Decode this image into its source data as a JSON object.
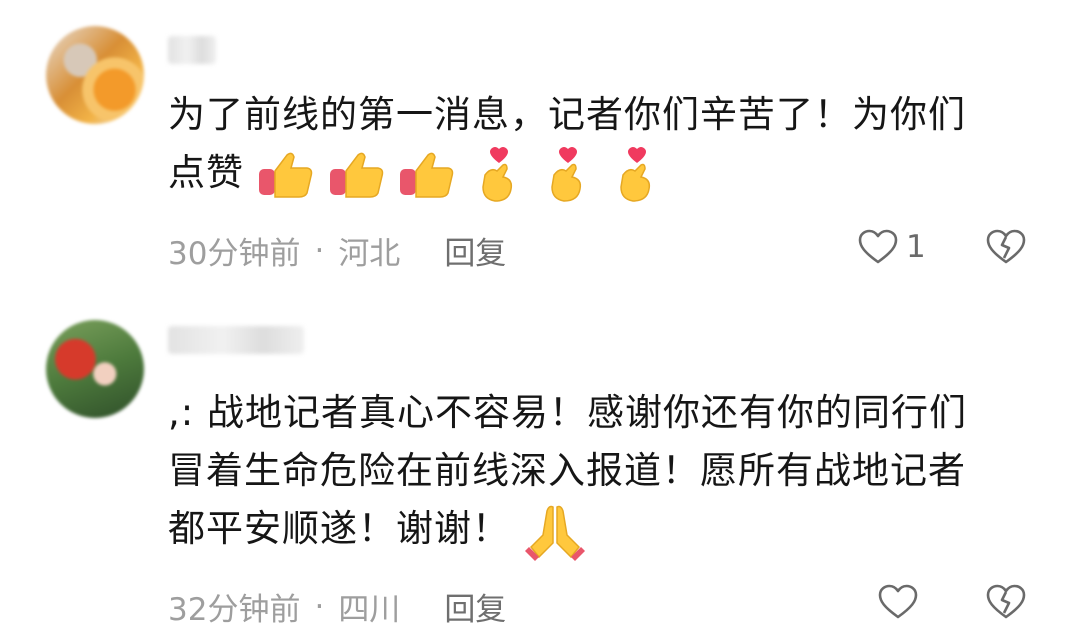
{
  "comments": [
    {
      "text_line1": "为了前线的第一消息，记者你们辛苦了！为你们",
      "text_line2": "点赞",
      "emoji": [
        "thumbs-up",
        "thumbs-up",
        "thumbs-up",
        "finger-heart",
        "finger-heart",
        "finger-heart"
      ],
      "time": "30分钟前",
      "location": "河北",
      "reply_label": "回复",
      "like_count": "1"
    },
    {
      "text_line1": ",:  战地记者真心不容易！感谢你还有你的同行们",
      "text_line2": "冒着生命危险在前线深入报道！愿所有战地记者",
      "text_line3": "都平安顺遂！谢谢！",
      "emoji": [
        "folded-hands"
      ],
      "time": "32分钟前",
      "location": "四川",
      "reply_label": "回复",
      "like_count": ""
    }
  ],
  "separator": "·",
  "colors": {
    "meta": "#9e9e9e",
    "reply": "#6f6f6f",
    "text": "#161616"
  }
}
